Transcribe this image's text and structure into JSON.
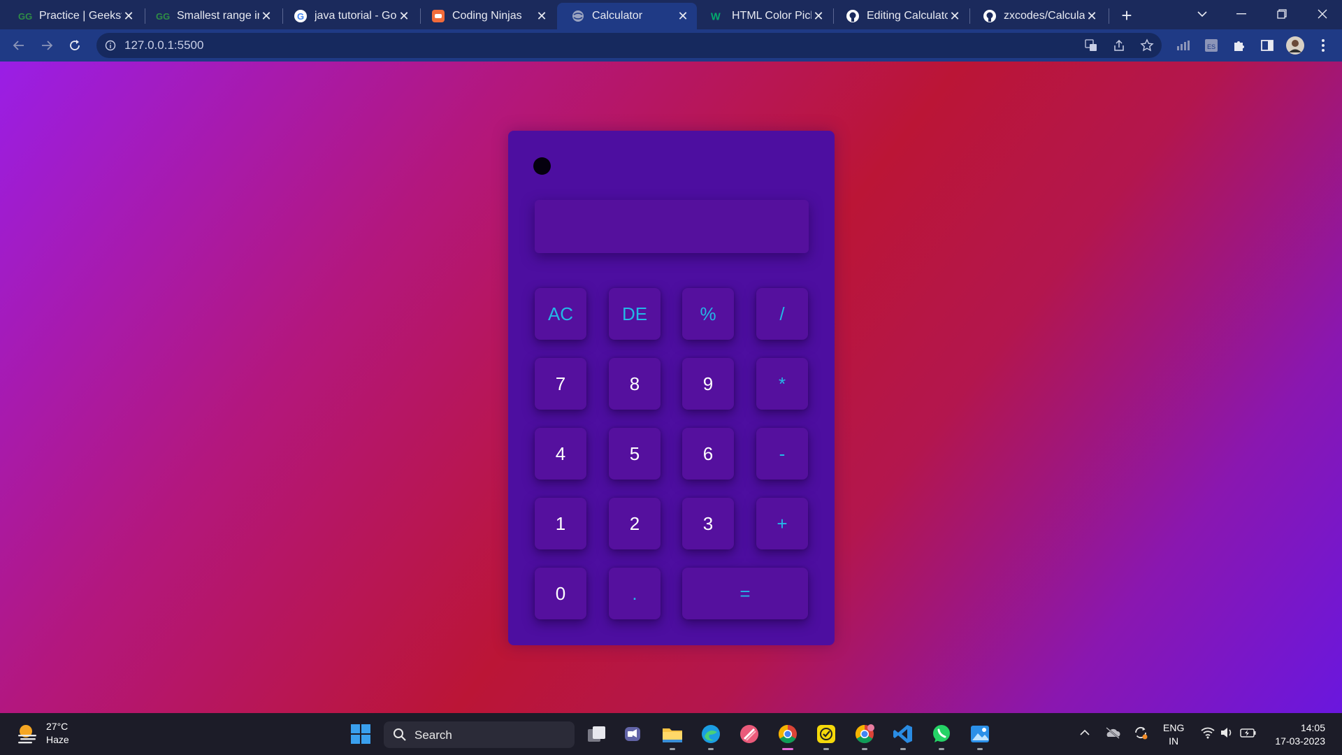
{
  "browser": {
    "tabs": [
      {
        "title": "Practice | GeeksforGeeks",
        "icon": "gfg-icon",
        "active": false
      },
      {
        "title": "Smallest range in",
        "icon": "gfg-icon",
        "active": false
      },
      {
        "title": "java tutorial - Google",
        "icon": "google-icon",
        "active": false
      },
      {
        "title": "Coding Ninjas",
        "icon": "coding-ninjas-icon",
        "active": false
      },
      {
        "title": "Calculator",
        "icon": "globe-icon",
        "active": true
      },
      {
        "title": "HTML Color Picker",
        "icon": "w3schools-icon",
        "active": false
      },
      {
        "title": "Editing Calculator",
        "icon": "github-icon",
        "active": false
      },
      {
        "title": "zxcodes/Calculator",
        "icon": "github-icon",
        "active": false
      }
    ],
    "url": "127.0.0.1:5500"
  },
  "calculator": {
    "display_value": "",
    "keys": [
      {
        "label": "AC",
        "kind": "op"
      },
      {
        "label": "DE",
        "kind": "op"
      },
      {
        "label": "%",
        "kind": "op"
      },
      {
        "label": "/",
        "kind": "op"
      },
      {
        "label": "7",
        "kind": "num"
      },
      {
        "label": "8",
        "kind": "num"
      },
      {
        "label": "9",
        "kind": "num"
      },
      {
        "label": "*",
        "kind": "op"
      },
      {
        "label": "4",
        "kind": "num"
      },
      {
        "label": "5",
        "kind": "num"
      },
      {
        "label": "6",
        "kind": "num"
      },
      {
        "label": "-",
        "kind": "op"
      },
      {
        "label": "1",
        "kind": "num"
      },
      {
        "label": "2",
        "kind": "num"
      },
      {
        "label": "3",
        "kind": "num"
      },
      {
        "label": "+",
        "kind": "op"
      },
      {
        "label": "0",
        "kind": "num"
      },
      {
        "label": ".",
        "kind": "op"
      },
      {
        "label": "=",
        "kind": "op"
      }
    ],
    "colors": {
      "operator_text": "#24b8e6",
      "number_text": "#ffffff",
      "body": "#4d0ea0"
    }
  },
  "taskbar": {
    "weather": {
      "temp": "27°C",
      "condition": "Haze"
    },
    "search_placeholder": "Search",
    "language": {
      "line1": "ENG",
      "line2": "IN"
    },
    "clock": {
      "time": "14:05",
      "date": "17-03-2023"
    }
  }
}
